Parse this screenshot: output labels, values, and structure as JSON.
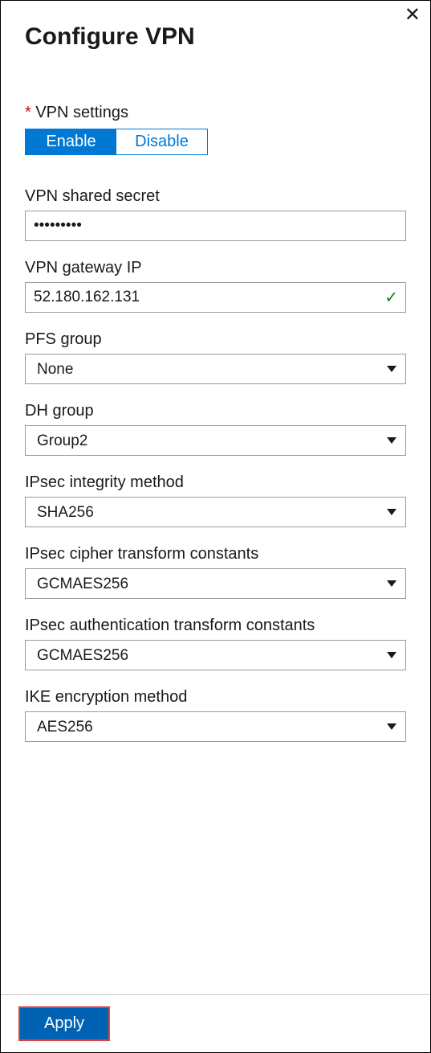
{
  "header": {
    "title": "Configure VPN"
  },
  "vpn_settings": {
    "label": "VPN settings",
    "enable": "Enable",
    "disable": "Disable"
  },
  "fields": {
    "shared_secret": {
      "label": "VPN shared secret",
      "value": "•••••••••"
    },
    "gateway_ip": {
      "label": "VPN gateway IP",
      "value": "52.180.162.131"
    },
    "pfs_group": {
      "label": "PFS group",
      "value": "None"
    },
    "dh_group": {
      "label": "DH group",
      "value": "Group2"
    },
    "ipsec_integrity": {
      "label": "IPsec integrity method",
      "value": "SHA256"
    },
    "ipsec_cipher": {
      "label": "IPsec cipher transform constants",
      "value": "GCMAES256"
    },
    "ipsec_auth": {
      "label": "IPsec authentication transform constants",
      "value": "GCMAES256"
    },
    "ike_encryption": {
      "label": "IKE encryption method",
      "value": "AES256"
    }
  },
  "footer": {
    "apply": "Apply"
  }
}
